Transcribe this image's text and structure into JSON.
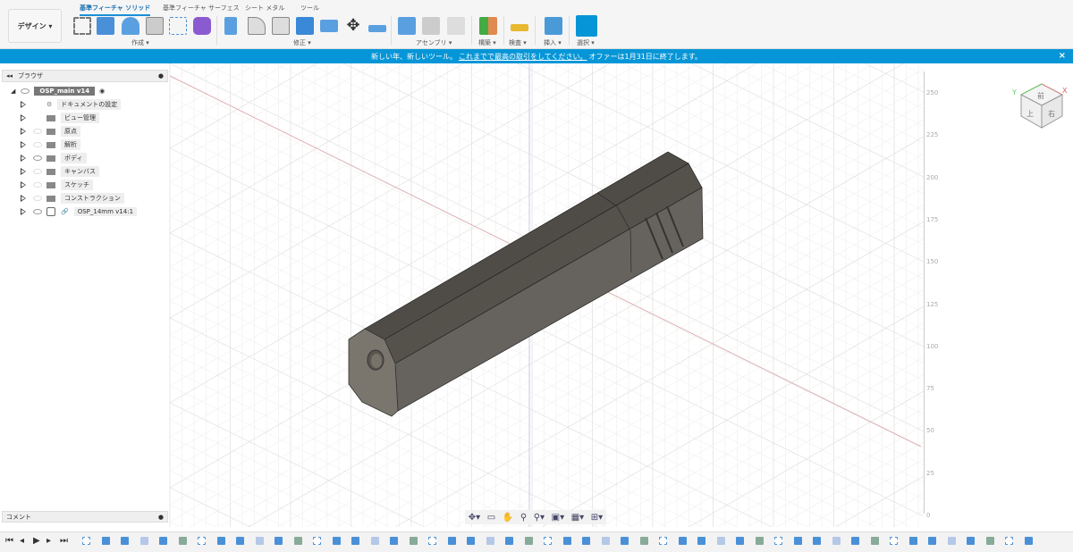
{
  "toolbar": {
    "workspace": "デザイン ▾",
    "tabs": [
      "基準フィーチャ ソリッド",
      "基準フィーチャ サーフェス",
      "シート メタル",
      "ツール"
    ],
    "groups": [
      "作成 ▾",
      "修正 ▾",
      "アセンブリ ▾",
      "構築 ▾",
      "検査 ▾",
      "挿入 ▾",
      "選択 ▾"
    ]
  },
  "banner": {
    "pre": "新しい年、新しいツール。",
    "link": "これまでで最高の取引をしてください。",
    "post": "オファーは1月31日に終了します。",
    "close": "×"
  },
  "browser": {
    "title": "ブラウザ",
    "root": "OSP_main v14",
    "items": [
      {
        "label": "ドキュメントの設定",
        "visible": null
      },
      {
        "label": "ビュー管理",
        "visible": null
      },
      {
        "label": "原点",
        "visible": false
      },
      {
        "label": "解析",
        "visible": false
      },
      {
        "label": "ボディ",
        "visible": true
      },
      {
        "label": "キャンバス",
        "visible": false
      },
      {
        "label": "スケッチ",
        "visible": false
      },
      {
        "label": "コンストラクション",
        "visible": false
      },
      {
        "label": "OSP_14mm v14:1",
        "visible": true
      }
    ]
  },
  "comments": {
    "title": "コメント"
  },
  "scale_ticks": [
    "250",
    "225",
    "200",
    "175",
    "150",
    "125",
    "100",
    "75",
    "50",
    "25",
    "0"
  ],
  "viewcube": {
    "top": "前",
    "left": "上",
    "right": "右",
    "x": "X",
    "y": "Y"
  },
  "colors": {
    "accent": "#0696d7",
    "body": "#5a5752"
  }
}
